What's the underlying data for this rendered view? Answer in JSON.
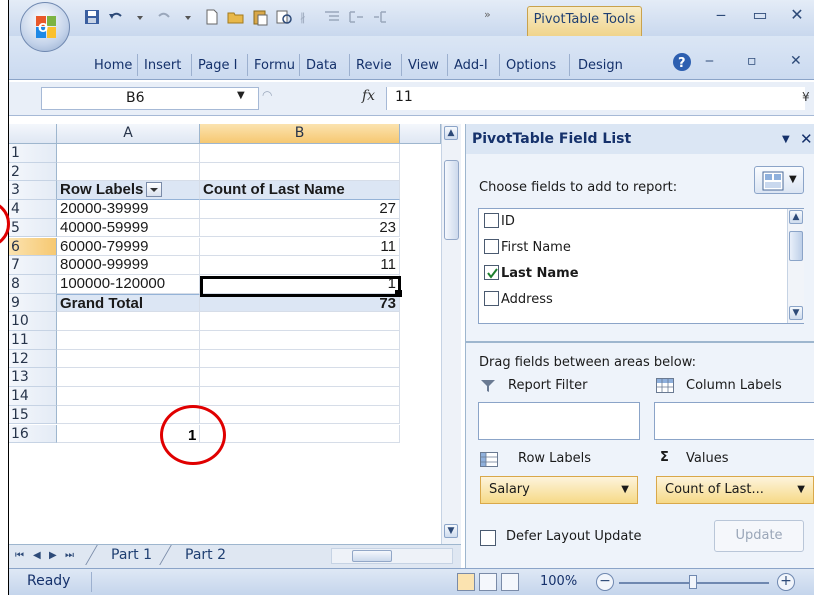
{
  "title_bar": {
    "context_tab": "PivotTable Tools",
    "qat_overflow": "»"
  },
  "ribbon": {
    "tabs": [
      "Home",
      "Insert",
      "Page I",
      "Formu",
      "Data",
      "Revie",
      "View",
      "Add-I",
      "Options",
      "Design"
    ]
  },
  "formula_bar": {
    "name_box": "B6",
    "fx": "fx",
    "value": "11"
  },
  "grid": {
    "columns": [
      "A",
      "B"
    ],
    "rows": [
      {
        "num": "1",
        "a": "",
        "b": ""
      },
      {
        "num": "2",
        "a": "",
        "b": ""
      },
      {
        "num": "3",
        "a": "Row Labels",
        "b": "Count of Last Name"
      },
      {
        "num": "4",
        "a": "20000-39999",
        "b": "27"
      },
      {
        "num": "5",
        "a": "40000-59999",
        "b": "23"
      },
      {
        "num": "6",
        "a": "60000-79999",
        "b": "11"
      },
      {
        "num": "7",
        "a": "80000-99999",
        "b": "11"
      },
      {
        "num": "8",
        "a": "100000-120000",
        "b": "1"
      },
      {
        "num": "9",
        "a": "Grand Total",
        "b": "73"
      },
      {
        "num": "10",
        "a": "",
        "b": ""
      },
      {
        "num": "11",
        "a": "",
        "b": ""
      },
      {
        "num": "12",
        "a": "",
        "b": ""
      },
      {
        "num": "13",
        "a": "",
        "b": ""
      },
      {
        "num": "14",
        "a": "",
        "b": ""
      },
      {
        "num": "15",
        "a": "",
        "b": ""
      },
      {
        "num": "16",
        "a": "",
        "b": ""
      }
    ],
    "active_cell": "B6",
    "annotation_label": "1"
  },
  "sheet_tabs": [
    "Part 1",
    "Part 2"
  ],
  "status_bar": {
    "status": "Ready",
    "zoom": "100%"
  },
  "pivot_field_list": {
    "title": "PivotTable Field List",
    "choose_label": "Choose fields to add to report:",
    "fields": [
      {
        "name": "ID",
        "checked": false
      },
      {
        "name": "First Name",
        "checked": false
      },
      {
        "name": "Last Name",
        "checked": true
      },
      {
        "name": "Address",
        "checked": false
      }
    ],
    "drag_label": "Drag fields between areas below:",
    "areas": {
      "report_filter": "Report Filter",
      "column_labels": "Column Labels",
      "row_labels": "Row Labels",
      "values": "Values",
      "values_symbol": "Σ"
    },
    "row_field": "Salary",
    "value_field": "Count of Last...",
    "defer_label": "Defer Layout Update",
    "update_button": "Update"
  },
  "colors": {
    "accent": "#15316b",
    "pivot_header_fill": "#dce6f4",
    "active_header": "#f6c871",
    "annotation": "#e00000",
    "pill_fill": "#f6d987"
  }
}
